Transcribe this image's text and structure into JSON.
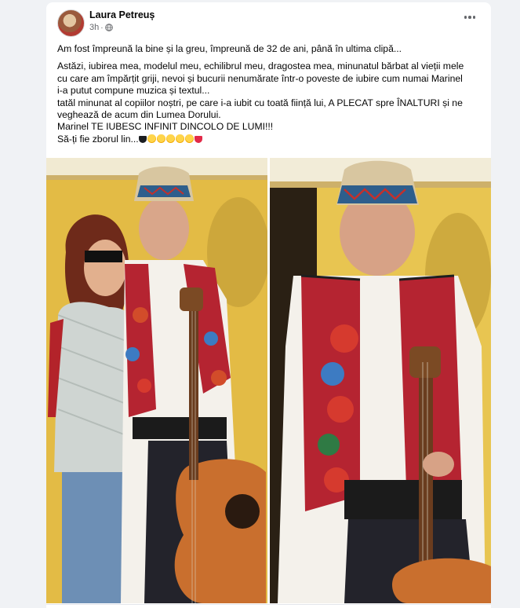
{
  "post": {
    "author": "Laura Petreuș",
    "time": "3h",
    "dot": "·",
    "privacy_icon": "globe-icon",
    "more_icon": "more-options-icon",
    "line1": "Am fost împreună la bine și la greu, împreună de 32 de ani, până în ultima clipă...",
    "line2": "Astăzi, iubirea mea, modelul meu, echilibrul meu, dragostea mea, minunatul bărbat al vieții mele",
    "line3": "cu care am împărțit griji, nevoi și bucurii nenumărate într-o poveste de iubire cum numai Marinel",
    "line4": "i-a putut compune muzica și textul...",
    "line5": "tatăl minunat al copiilor noștri, pe care i-a iubit cu toată ființă lui, A PLECAT spre ÎNALTURI și ne",
    "line6": "veghează de acum din Lumea Dorului.",
    "line7": "Marinel TE IUBESC INFINIT DINCOLO DE LUMI!!!",
    "line8": "Să-ți fie zborul lin...",
    "emojis": [
      "black-heart",
      "crying-face",
      "crying-face",
      "crying-face",
      "crying-face",
      "crying-face",
      "red-heart"
    ]
  },
  "photos": [
    {
      "name": "photo-couple",
      "description_icon": "photo"
    },
    {
      "name": "photo-man-guitar",
      "description_icon": "photo"
    }
  ],
  "colors": {
    "background": "#f0f2f5",
    "card": "#ffffff",
    "secondary_text": "#65676b",
    "vest_red": "#c1272d",
    "wall_yellow": "#e7c24a"
  }
}
